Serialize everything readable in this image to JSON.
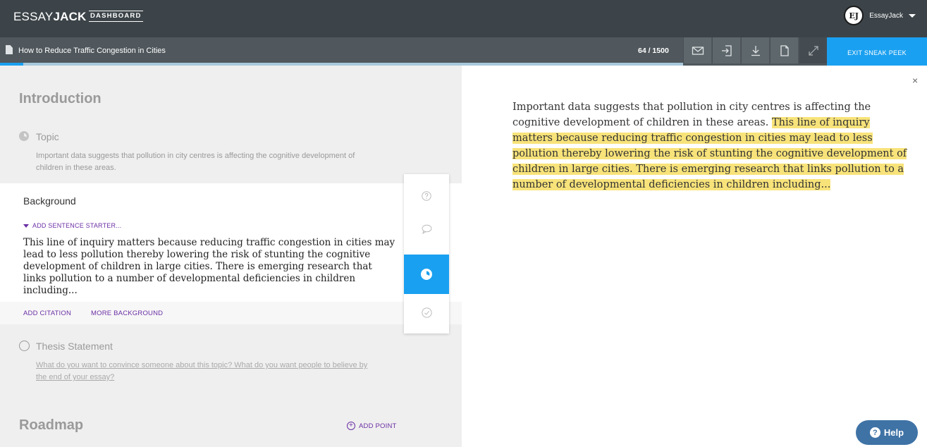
{
  "nav": {
    "logo_part1": "ESSAY",
    "logo_part2": "JACK",
    "dashboard_label": "DASHBOARD",
    "avatar_initials": "EJ",
    "user_name": "EssayJack"
  },
  "toolbar": {
    "doc_title": "How to Reduce Traffic Congestion in Cities",
    "word_count": "64 / 1500",
    "exit_label": "EXIT SNEAK PEEK",
    "progress_fraction": 0.034
  },
  "editor": {
    "introduction_title": "Introduction",
    "topic_label": "Topic",
    "topic_text": "Important data suggests that pollution in city centres is affecting the cognitive development of children in these areas.",
    "background_label": "Background",
    "sentence_starter_label": "ADD SENTENCE STARTER...",
    "background_text": "This line of inquiry matters because reducing traffic congestion in cities may lead to less pollution thereby lowering the risk of stunting the cognitive development of children in large cities. There is emerging research that links pollution to a number of developmental deficiencies in children including...",
    "add_citation_label": "ADD CITATION",
    "more_background_label": "MORE BACKGROUND",
    "thesis_label": "Thesis Statement",
    "thesis_prompt": "What do you want to convince someone about this topic? What do you want people to believe by the end of your essay?",
    "roadmap_title": "Roadmap",
    "add_point_label": "ADD POINT"
  },
  "preview": {
    "plain_text": "Important data suggests that pollution in city centres is affecting the cognitive development of children in these areas. ",
    "highlighted_text": "This line of inquiry matters because reducing traffic congestion in cities may lead to less pollution thereby lowering the risk of stunting the cognitive development of children in large cities. There is emerging research that links pollution to a number of developmental deficiencies in children including...",
    "close_symbol": "×"
  },
  "help": {
    "label": "Help",
    "icon_symbol": "?"
  },
  "icons": [
    "document-icon",
    "email-icon",
    "import-icon",
    "download-icon",
    "copy-icon",
    "expand-icon",
    "question-icon",
    "comment-icon",
    "clock-icon",
    "check-icon"
  ]
}
